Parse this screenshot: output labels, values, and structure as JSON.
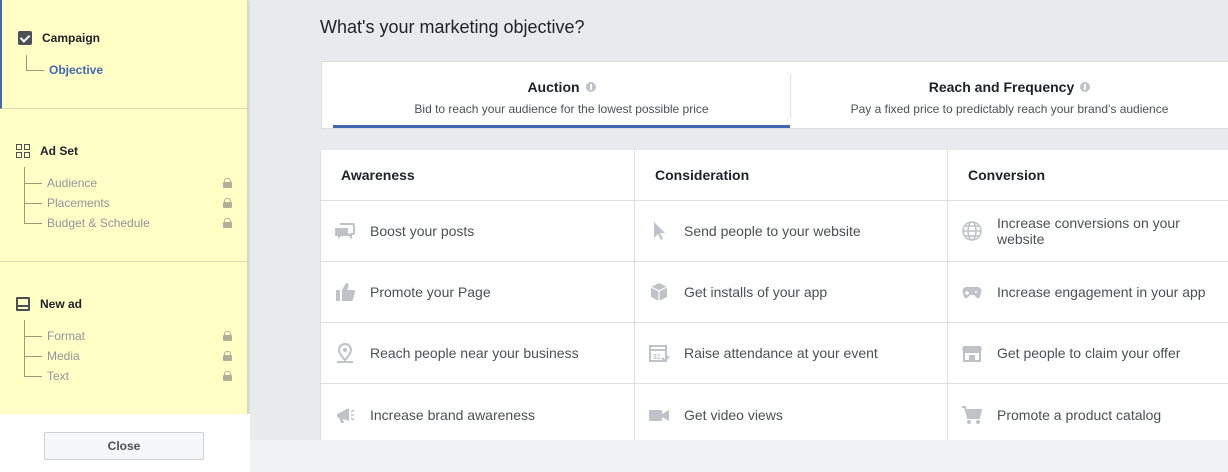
{
  "sidebar": {
    "campaign": {
      "title": "Campaign",
      "items": [
        {
          "label": "Objective"
        }
      ]
    },
    "adset": {
      "title": "Ad Set",
      "items": [
        {
          "label": "Audience"
        },
        {
          "label": "Placements"
        },
        {
          "label": "Budget & Schedule"
        }
      ]
    },
    "newad": {
      "title": "New ad",
      "items": [
        {
          "label": "Format"
        },
        {
          "label": "Media"
        },
        {
          "label": "Text"
        }
      ]
    },
    "close_label": "Close"
  },
  "main": {
    "title": "What's your marketing objective?",
    "buying_types": [
      {
        "name": "Auction",
        "description": "Bid to reach your audience for the lowest possible price"
      },
      {
        "name": "Reach and Frequency",
        "description": "Pay a fixed price to predictably reach your brand's audience"
      }
    ],
    "columns": [
      {
        "header": "Awareness",
        "items": [
          {
            "label": "Boost your posts",
            "icon": "chat-bubbles-icon"
          },
          {
            "label": "Promote your Page",
            "icon": "thumbs-up-icon"
          },
          {
            "label": "Reach people near your business",
            "icon": "location-pin-icon"
          },
          {
            "label": "Increase brand awareness",
            "icon": "megaphone-icon"
          }
        ]
      },
      {
        "header": "Consideration",
        "items": [
          {
            "label": "Send people to your website",
            "icon": "cursor-icon"
          },
          {
            "label": "Get installs of your app",
            "icon": "box-icon"
          },
          {
            "label": "Raise attendance at your event",
            "icon": "calendar-icon"
          },
          {
            "label": "Get video views",
            "icon": "video-camera-icon"
          }
        ]
      },
      {
        "header": "Conversion",
        "items": [
          {
            "label": "Increase conversions on your website",
            "icon": "globe-icon"
          },
          {
            "label": "Increase engagement in your app",
            "icon": "gamepad-icon"
          },
          {
            "label": "Get people to claim your offer",
            "icon": "storefront-icon"
          },
          {
            "label": "Promote a product catalog",
            "icon": "shopping-cart-icon"
          }
        ]
      }
    ]
  },
  "colors": {
    "accent": "#4267b2",
    "sidebar_bg": "#ffffc6",
    "icon_gray": "#bec2c9"
  }
}
